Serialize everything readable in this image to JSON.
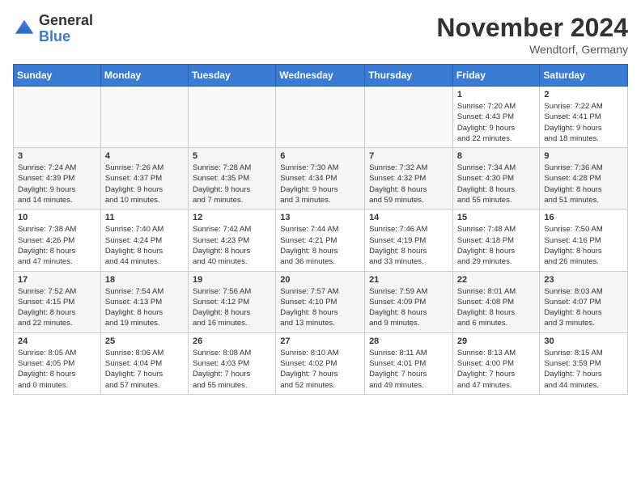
{
  "app": {
    "logo_general": "General",
    "logo_blue": "Blue"
  },
  "header": {
    "title": "November 2024",
    "location": "Wendtorf, Germany"
  },
  "weekdays": [
    "Sunday",
    "Monday",
    "Tuesday",
    "Wednesday",
    "Thursday",
    "Friday",
    "Saturday"
  ],
  "weeks": [
    [
      {
        "day": "",
        "info": ""
      },
      {
        "day": "",
        "info": ""
      },
      {
        "day": "",
        "info": ""
      },
      {
        "day": "",
        "info": ""
      },
      {
        "day": "",
        "info": ""
      },
      {
        "day": "1",
        "info": "Sunrise: 7:20 AM\nSunset: 4:43 PM\nDaylight: 9 hours\nand 22 minutes."
      },
      {
        "day": "2",
        "info": "Sunrise: 7:22 AM\nSunset: 4:41 PM\nDaylight: 9 hours\nand 18 minutes."
      }
    ],
    [
      {
        "day": "3",
        "info": "Sunrise: 7:24 AM\nSunset: 4:39 PM\nDaylight: 9 hours\nand 14 minutes."
      },
      {
        "day": "4",
        "info": "Sunrise: 7:26 AM\nSunset: 4:37 PM\nDaylight: 9 hours\nand 10 minutes."
      },
      {
        "day": "5",
        "info": "Sunrise: 7:28 AM\nSunset: 4:35 PM\nDaylight: 9 hours\nand 7 minutes."
      },
      {
        "day": "6",
        "info": "Sunrise: 7:30 AM\nSunset: 4:34 PM\nDaylight: 9 hours\nand 3 minutes."
      },
      {
        "day": "7",
        "info": "Sunrise: 7:32 AM\nSunset: 4:32 PM\nDaylight: 8 hours\nand 59 minutes."
      },
      {
        "day": "8",
        "info": "Sunrise: 7:34 AM\nSunset: 4:30 PM\nDaylight: 8 hours\nand 55 minutes."
      },
      {
        "day": "9",
        "info": "Sunrise: 7:36 AM\nSunset: 4:28 PM\nDaylight: 8 hours\nand 51 minutes."
      }
    ],
    [
      {
        "day": "10",
        "info": "Sunrise: 7:38 AM\nSunset: 4:26 PM\nDaylight: 8 hours\nand 47 minutes."
      },
      {
        "day": "11",
        "info": "Sunrise: 7:40 AM\nSunset: 4:24 PM\nDaylight: 8 hours\nand 44 minutes."
      },
      {
        "day": "12",
        "info": "Sunrise: 7:42 AM\nSunset: 4:23 PM\nDaylight: 8 hours\nand 40 minutes."
      },
      {
        "day": "13",
        "info": "Sunrise: 7:44 AM\nSunset: 4:21 PM\nDaylight: 8 hours\nand 36 minutes."
      },
      {
        "day": "14",
        "info": "Sunrise: 7:46 AM\nSunset: 4:19 PM\nDaylight: 8 hours\nand 33 minutes."
      },
      {
        "day": "15",
        "info": "Sunrise: 7:48 AM\nSunset: 4:18 PM\nDaylight: 8 hours\nand 29 minutes."
      },
      {
        "day": "16",
        "info": "Sunrise: 7:50 AM\nSunset: 4:16 PM\nDaylight: 8 hours\nand 26 minutes."
      }
    ],
    [
      {
        "day": "17",
        "info": "Sunrise: 7:52 AM\nSunset: 4:15 PM\nDaylight: 8 hours\nand 22 minutes."
      },
      {
        "day": "18",
        "info": "Sunrise: 7:54 AM\nSunset: 4:13 PM\nDaylight: 8 hours\nand 19 minutes."
      },
      {
        "day": "19",
        "info": "Sunrise: 7:56 AM\nSunset: 4:12 PM\nDaylight: 8 hours\nand 16 minutes."
      },
      {
        "day": "20",
        "info": "Sunrise: 7:57 AM\nSunset: 4:10 PM\nDaylight: 8 hours\nand 13 minutes."
      },
      {
        "day": "21",
        "info": "Sunrise: 7:59 AM\nSunset: 4:09 PM\nDaylight: 8 hours\nand 9 minutes."
      },
      {
        "day": "22",
        "info": "Sunrise: 8:01 AM\nSunset: 4:08 PM\nDaylight: 8 hours\nand 6 minutes."
      },
      {
        "day": "23",
        "info": "Sunrise: 8:03 AM\nSunset: 4:07 PM\nDaylight: 8 hours\nand 3 minutes."
      }
    ],
    [
      {
        "day": "24",
        "info": "Sunrise: 8:05 AM\nSunset: 4:05 PM\nDaylight: 8 hours\nand 0 minutes."
      },
      {
        "day": "25",
        "info": "Sunrise: 8:06 AM\nSunset: 4:04 PM\nDaylight: 7 hours\nand 57 minutes."
      },
      {
        "day": "26",
        "info": "Sunrise: 8:08 AM\nSunset: 4:03 PM\nDaylight: 7 hours\nand 55 minutes."
      },
      {
        "day": "27",
        "info": "Sunrise: 8:10 AM\nSunset: 4:02 PM\nDaylight: 7 hours\nand 52 minutes."
      },
      {
        "day": "28",
        "info": "Sunrise: 8:11 AM\nSunset: 4:01 PM\nDaylight: 7 hours\nand 49 minutes."
      },
      {
        "day": "29",
        "info": "Sunrise: 8:13 AM\nSunset: 4:00 PM\nDaylight: 7 hours\nand 47 minutes."
      },
      {
        "day": "30",
        "info": "Sunrise: 8:15 AM\nSunset: 3:59 PM\nDaylight: 7 hours\nand 44 minutes."
      }
    ]
  ]
}
